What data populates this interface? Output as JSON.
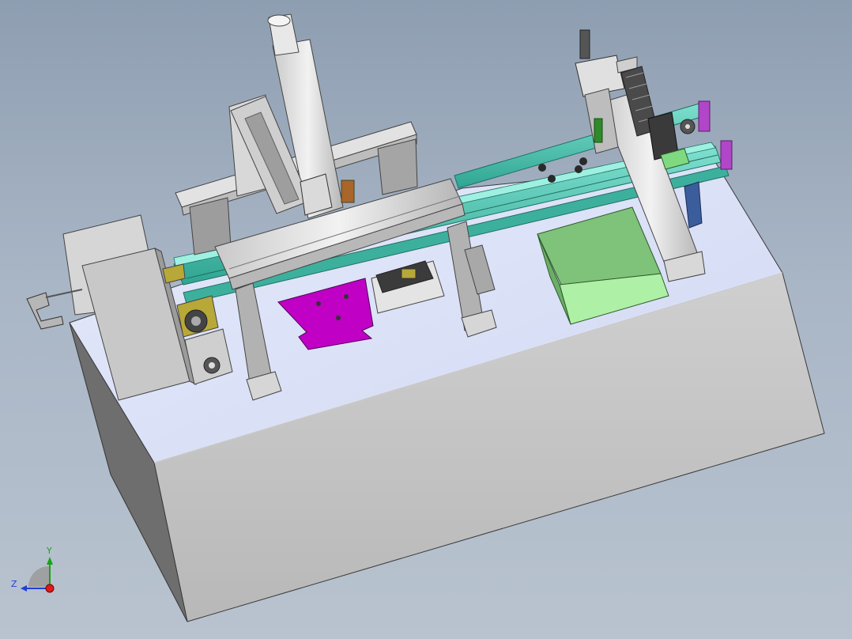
{
  "viewport": {
    "title": "",
    "colors": {
      "background_top": "#8e9eb1",
      "background_bottom": "#b9c3cf",
      "table_top": "#d9e0f6",
      "table_front": "#c4c4c4",
      "table_left": "#6b6b6b",
      "rail_teal": "#49c0ad",
      "bracket_magenta": "#c000c4",
      "bin_green": "#7fc27a",
      "motor_olive": "#b8a838",
      "end_cap_purple": "#b146c8"
    }
  },
  "triad": {
    "y_label": "Y",
    "z_label": "Z",
    "y_color": "#18a418",
    "z_color": "#1f3fd8",
    "x_color": "#e01a1a"
  }
}
